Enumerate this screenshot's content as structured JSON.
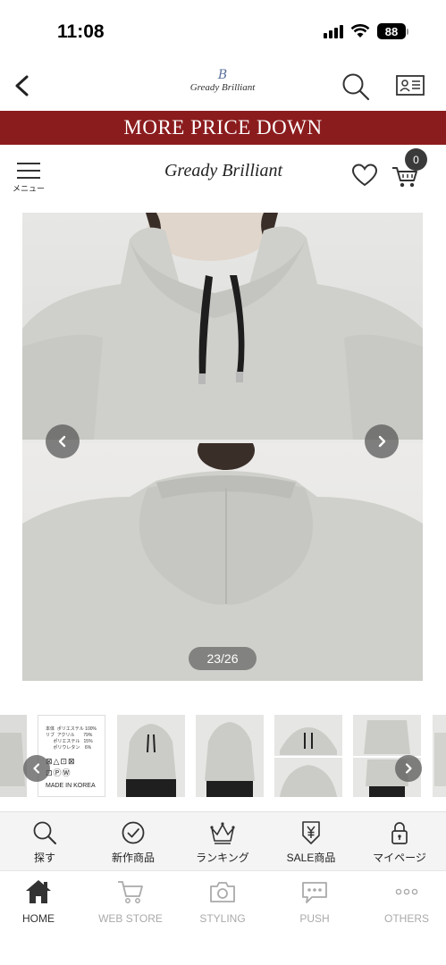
{
  "status_bar": {
    "time": "11:08",
    "battery": "88"
  },
  "header": {
    "brand_mark": "B",
    "brand_name": "Gready Brilliant"
  },
  "promo": {
    "text": "MORE PRICE DOWN"
  },
  "store_header": {
    "menu_label": "メニュー",
    "brand": "Gready Brilliant",
    "cart_count": "0"
  },
  "gallery": {
    "counter": "23/26"
  },
  "size_tag": {
    "lines": "本体  ポリエステル 100%\nリブ  アクリル       79%\n      ポリエステル   15%\n      ポリウレタン    6%",
    "care_symbols": "⊠△⊡⊠\n⊡ⓅⓌ",
    "made_in": "MADE IN KOREA"
  },
  "category_nav": {
    "items": [
      {
        "label": "探す",
        "icon": "search-icon"
      },
      {
        "label": "新作商品",
        "icon": "check-circle-icon"
      },
      {
        "label": "ランキング",
        "icon": "crown-icon"
      },
      {
        "label": "SALE商品",
        "icon": "yen-tag-icon"
      },
      {
        "label": "マイページ",
        "icon": "lock-icon"
      }
    ]
  },
  "tab_bar": {
    "items": [
      {
        "label": "HOME",
        "icon": "home-icon",
        "active": true
      },
      {
        "label": "WEB STORE",
        "icon": "cart-icon",
        "active": false
      },
      {
        "label": "STYLING",
        "icon": "camera-icon",
        "active": false
      },
      {
        "label": "PUSH",
        "icon": "chat-bubble-icon",
        "active": false
      },
      {
        "label": "OTHERS",
        "icon": "more-dots-icon",
        "active": false
      }
    ]
  },
  "colors": {
    "promo_bg": "#8b1c1e",
    "brand_mark": "#5a6f9a",
    "active_tab": "#333333",
    "inactive_tab": "#aaaaaa"
  }
}
